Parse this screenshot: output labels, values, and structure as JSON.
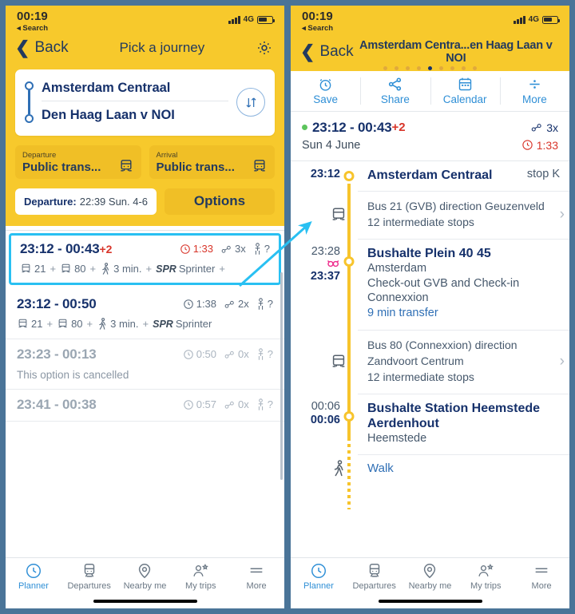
{
  "theme": {
    "yellow": "#f7c92c",
    "yellow_dark": "#f0bf26",
    "navy": "#16316b",
    "blue": "#2f8fd6",
    "red": "#d8352a",
    "cyan": "#29c0f2",
    "frame": "#4a7498",
    "green": "#5cc45c",
    "pink": "#ee2a8b"
  },
  "left": {
    "status": {
      "time": "00:19",
      "back": "Search",
      "network": "4G"
    },
    "nav": {
      "back": "Back",
      "title": "Pick a journey",
      "gear_icon": "gear-icon"
    },
    "search_card": {
      "origin": "Amsterdam Centraal",
      "destination": "Den Haag Laan v NOI",
      "swap_icon": "swap-vertical-icon"
    },
    "modes": [
      {
        "label": "Departure",
        "value": "Public trans...",
        "icon": "bus-icon"
      },
      {
        "label": "Arrival",
        "value": "Public trans...",
        "icon": "bus-icon"
      }
    ],
    "departure_pill": {
      "label": "Departure:",
      "value": "22:39 Sun. 4-6"
    },
    "options_button": "Options",
    "results": [
      {
        "selected": true,
        "cancelled": false,
        "time": "23:12 - 00:43",
        "delay": "+2",
        "duration": "1:33",
        "duration_delayed": true,
        "transfers": "3x",
        "crowding": "?",
        "legs": [
          {
            "icon": "bus-icon",
            "text": "21"
          },
          {
            "icon": "bus-icon",
            "text": "80"
          },
          {
            "icon": "walk-icon",
            "text": "3 min."
          },
          {
            "icon": "train-code",
            "code": "SPR",
            "text": "Sprinter"
          }
        ],
        "trailing_plus": true
      },
      {
        "selected": false,
        "cancelled": false,
        "time": "23:12 - 00:50",
        "delay": "",
        "duration": "1:38",
        "duration_delayed": false,
        "transfers": "2x",
        "crowding": "?",
        "legs": [
          {
            "icon": "bus-icon",
            "text": "21"
          },
          {
            "icon": "bus-icon",
            "text": "80"
          },
          {
            "icon": "walk-icon",
            "text": "3 min."
          },
          {
            "icon": "train-code",
            "code": "SPR",
            "text": "Sprinter"
          }
        ],
        "trailing_plus": false
      },
      {
        "selected": false,
        "cancelled": true,
        "time": "23:23 - 00:13",
        "delay": "",
        "duration": "0:50",
        "duration_delayed": false,
        "transfers": "0x",
        "crowding": "?",
        "cancel_text": "This option is cancelled"
      },
      {
        "selected": false,
        "cancelled": false,
        "partial": true,
        "time": "23:41 - 00:38",
        "delay": "",
        "duration": "0:57",
        "duration_delayed": false,
        "transfers": "0x",
        "crowding": "?"
      }
    ],
    "tabs": [
      {
        "label": "Planner",
        "icon": "clock-icon",
        "active": true
      },
      {
        "label": "Departures",
        "icon": "train-icon",
        "active": false
      },
      {
        "label": "Nearby me",
        "icon": "pin-icon",
        "active": false
      },
      {
        "label": "My trips",
        "icon": "user-star-icon",
        "active": false
      },
      {
        "label": "More",
        "icon": "hamburger-icon",
        "active": false
      }
    ]
  },
  "right": {
    "status": {
      "time": "00:19",
      "back": "Search",
      "network": "4G"
    },
    "nav": {
      "back": "Back",
      "title": "Amsterdam Centra...en Haag Laan v NOI",
      "dots_total": 9,
      "dots_active_index": 4
    },
    "actions": [
      {
        "label": "Save",
        "icon": "alarm-icon"
      },
      {
        "label": "Share",
        "icon": "share-icon"
      },
      {
        "label": "Calendar",
        "icon": "calendar-icon"
      },
      {
        "label": "More",
        "icon": "divide-more-icon"
      }
    ],
    "summary": {
      "status_dot": "on-time-dot",
      "time": "23:12 - 00:43",
      "delay": "+2",
      "date": "Sun 4 June",
      "transfers": "3x",
      "duration": "1:33"
    },
    "timeline": [
      {
        "kind": "stop",
        "dep": "23:12",
        "arr": "",
        "name": "Amsterdam Centraal",
        "city": "",
        "right": "stop K",
        "node": true
      },
      {
        "kind": "leg",
        "icon": "bus-icon",
        "lines": [
          "Bus 21 (GVB) direction Geuzenveld",
          "12 intermediate stops"
        ],
        "chevron": true
      },
      {
        "kind": "stop",
        "dep": "23:28",
        "arr": "23:37",
        "transfer_icon": "transfer-icon",
        "name": "Bushalte Plein 40 45",
        "city": "Amsterdam",
        "extra": "Check-out GVB and Check-in Connexxion",
        "transfer_note": "9 min transfer",
        "node": true
      },
      {
        "kind": "leg",
        "icon": "bus-icon",
        "lines": [
          "Bus 80 (Connexxion) direction",
          "Zandvoort Centrum",
          "12 intermediate stops"
        ],
        "chevron": true
      },
      {
        "kind": "stop",
        "dep": "00:06",
        "arr": "00:06",
        "name": "Bushalte Station Heemstede Aerdenhout",
        "city": "Heemstede",
        "node": true
      },
      {
        "kind": "leg",
        "icon": "walk-icon",
        "lines": [
          "Walk"
        ],
        "link": true,
        "chevron": false
      }
    ],
    "tabs": [
      {
        "label": "Planner",
        "icon": "clock-icon",
        "active": true
      },
      {
        "label": "Departures",
        "icon": "train-icon",
        "active": false
      },
      {
        "label": "Nearby me",
        "icon": "pin-icon",
        "active": false
      },
      {
        "label": "My trips",
        "icon": "user-star-icon",
        "active": false
      },
      {
        "label": "More",
        "icon": "hamburger-icon",
        "active": false
      }
    ]
  },
  "annotation": {
    "arrow_icon": "callout-arrow-icon",
    "color": "#29c0f2"
  }
}
